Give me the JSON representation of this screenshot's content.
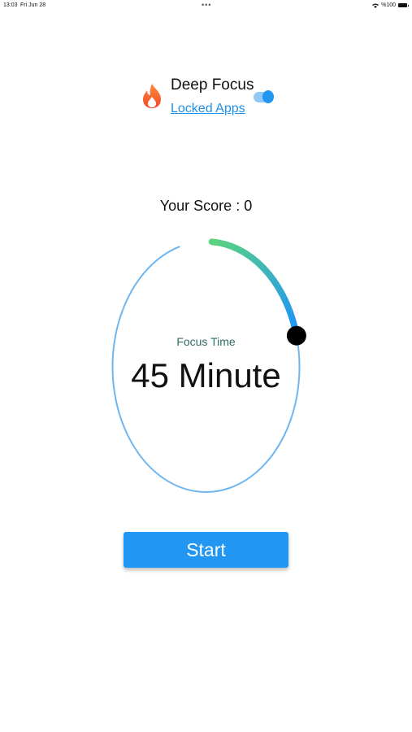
{
  "status_bar": {
    "time": "13:03",
    "date": "Fri Jun 28",
    "dots": "•••",
    "battery_label": "%100"
  },
  "header": {
    "title": "Deep Focus",
    "locked_apps_link": "Locked Apps",
    "toggle_on": true,
    "icon": "flame-icon"
  },
  "score": {
    "label": "Your Score : 0"
  },
  "timer": {
    "label": "Focus Time",
    "value_text": "45 Minute",
    "progress_fraction": 0.21,
    "colors": {
      "track": "#6fb6f0",
      "progress_start": "#5dd67a",
      "progress_end": "#2196f3",
      "handle": "#000000"
    }
  },
  "start_button": {
    "label": "Start",
    "color": "#2196f3"
  }
}
